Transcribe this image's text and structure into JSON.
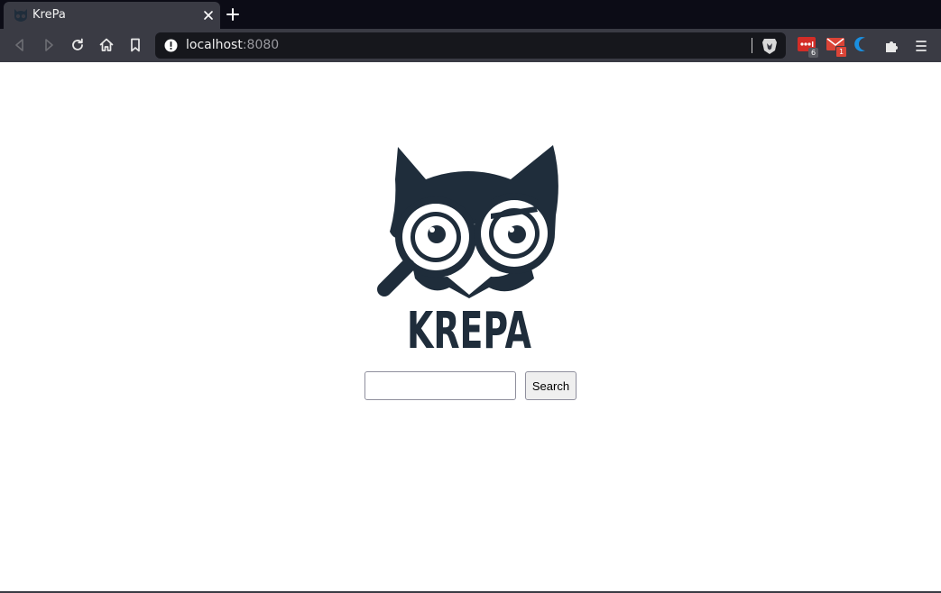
{
  "browser": {
    "tab": {
      "title": "KrePa",
      "favicon": "owl-favicon-icon"
    },
    "address_bar": {
      "host": "localhost",
      "port": ":8080"
    },
    "extensions": [
      {
        "name": "lastpass-icon",
        "badge": "6",
        "color": "#d32d27"
      },
      {
        "name": "mail-icon",
        "badge": "1",
        "color": "#db4437"
      },
      {
        "name": "crescent-extension-icon",
        "color": "#1a8fe0"
      }
    ]
  },
  "page": {
    "logo_text": "KREPA",
    "search": {
      "value": "",
      "placeholder": "",
      "button_label": "Search"
    }
  },
  "colors": {
    "logo": "#1f2d3b",
    "chrome_dark": "#0c0c16",
    "chrome": "#3a3b44"
  }
}
